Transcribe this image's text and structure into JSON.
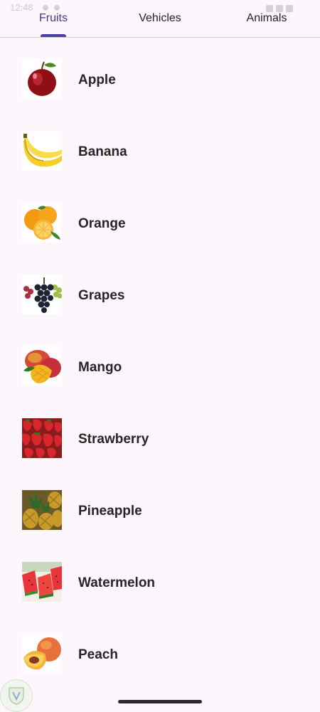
{
  "status_bar": {
    "time": "12:48"
  },
  "tabs": [
    {
      "label": "Fruits",
      "active": true
    },
    {
      "label": "Vehicles",
      "active": false
    },
    {
      "label": "Animals",
      "active": false
    }
  ],
  "colors": {
    "accent": "#4a3fa0",
    "background": "#fdf6fd"
  },
  "items": [
    {
      "name": "Apple",
      "icon": "apple-icon"
    },
    {
      "name": "Banana",
      "icon": "banana-icon"
    },
    {
      "name": "Orange",
      "icon": "orange-icon"
    },
    {
      "name": "Grapes",
      "icon": "grapes-icon"
    },
    {
      "name": "Mango",
      "icon": "mango-icon"
    },
    {
      "name": "Strawberry",
      "icon": "strawberry-icon"
    },
    {
      "name": "Pineapple",
      "icon": "pineapple-icon"
    },
    {
      "name": "Watermelon",
      "icon": "watermelon-icon"
    },
    {
      "name": "Peach",
      "icon": "peach-icon"
    }
  ]
}
